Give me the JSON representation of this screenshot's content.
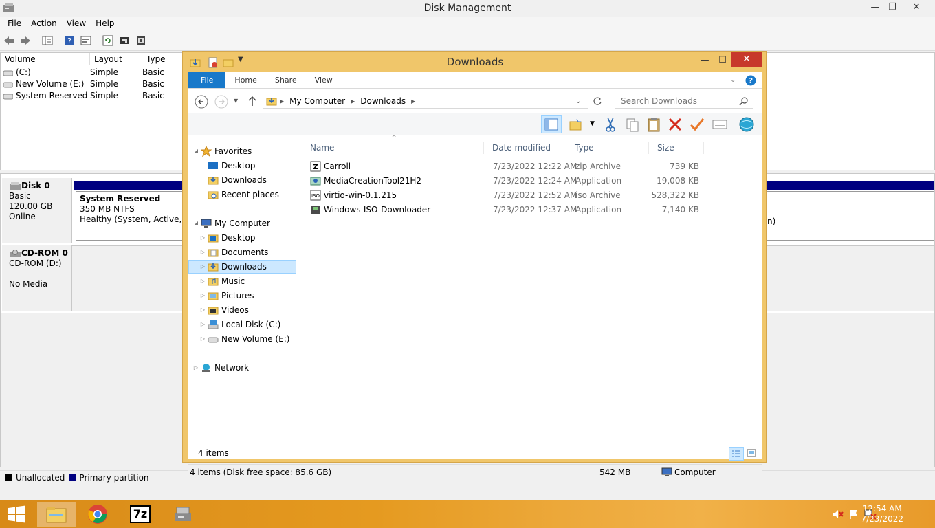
{
  "disk_management": {
    "title": "Disk Management",
    "menu": [
      "File",
      "Action",
      "View",
      "Help"
    ],
    "volume_columns": [
      "Volume",
      "Layout",
      "Type"
    ],
    "volumes": [
      {
        "name": "(C:)",
        "layout": "Simple",
        "type": "Basic"
      },
      {
        "name": "New Volume (E:)",
        "layout": "Simple",
        "type": "Basic"
      },
      {
        "name": "System Reserved",
        "layout": "Simple",
        "type": "Basic"
      }
    ],
    "disk0": {
      "name": "Disk 0",
      "kind": "Basic",
      "size": "120.00 GB",
      "status": "Online"
    },
    "partition": {
      "name": "System Reserved",
      "size": "350 MB NTFS",
      "status": "Healthy (System, Active, Pri",
      "overflow_right": "n)"
    },
    "cdrom": {
      "name": "CD-ROM 0",
      "drive": "CD-ROM (D:)",
      "media": "No Media"
    },
    "legend": {
      "unallocated": "Unallocated",
      "primary": "Primary partition"
    },
    "colors": {
      "unallocated": "#000000",
      "primary": "#000080"
    }
  },
  "explorer": {
    "title": "Downloads",
    "ribbon_tabs": [
      "File",
      "Home",
      "Share",
      "View"
    ],
    "breadcrumb": [
      "My Computer",
      "Downloads"
    ],
    "search_placeholder": "Search Downloads",
    "sort_indicator": "^",
    "columns": {
      "name": "Name",
      "date": "Date modified",
      "type": "Type",
      "size": "Size"
    },
    "files": [
      {
        "name": "Carroll",
        "date": "7/23/2022 12:22 AM",
        "type": "zip Archive",
        "size": "739 KB",
        "icon": "zip-icon"
      },
      {
        "name": "MediaCreationTool21H2",
        "date": "7/23/2022 12:24 AM",
        "type": "Application",
        "size": "19,008 KB",
        "icon": "app-icon"
      },
      {
        "name": "virtio-win-0.1.215",
        "date": "7/23/2022 12:52 AM",
        "type": "iso Archive",
        "size": "528,322 KB",
        "icon": "iso-icon"
      },
      {
        "name": "Windows-ISO-Downloader",
        "date": "7/23/2022 12:37 AM",
        "type": "Application",
        "size": "7,140 KB",
        "icon": "app-icon"
      }
    ],
    "nav": {
      "favorites": "Favorites",
      "fav_items": [
        "Desktop",
        "Downloads",
        "Recent places"
      ],
      "computer": "My Computer",
      "computer_items": [
        "Desktop",
        "Documents",
        "Downloads",
        "Music",
        "Pictures",
        "Videos",
        "Local Disk (C:)",
        "New Volume (E:)"
      ],
      "network": "Network"
    },
    "item_count": "4 items",
    "status_text": "4 items (Disk free space: 85.6 GB)",
    "status_size": "542 MB",
    "status_location": "Computer",
    "accent": "#1979ca"
  },
  "taskbar": {
    "time": "12:54 AM",
    "date": "7/23/2022",
    "apps": [
      "file-explorer-icon",
      "chrome-icon",
      "7zip-icon",
      "disk-management-icon"
    ],
    "seven_zip_label": "7z"
  }
}
